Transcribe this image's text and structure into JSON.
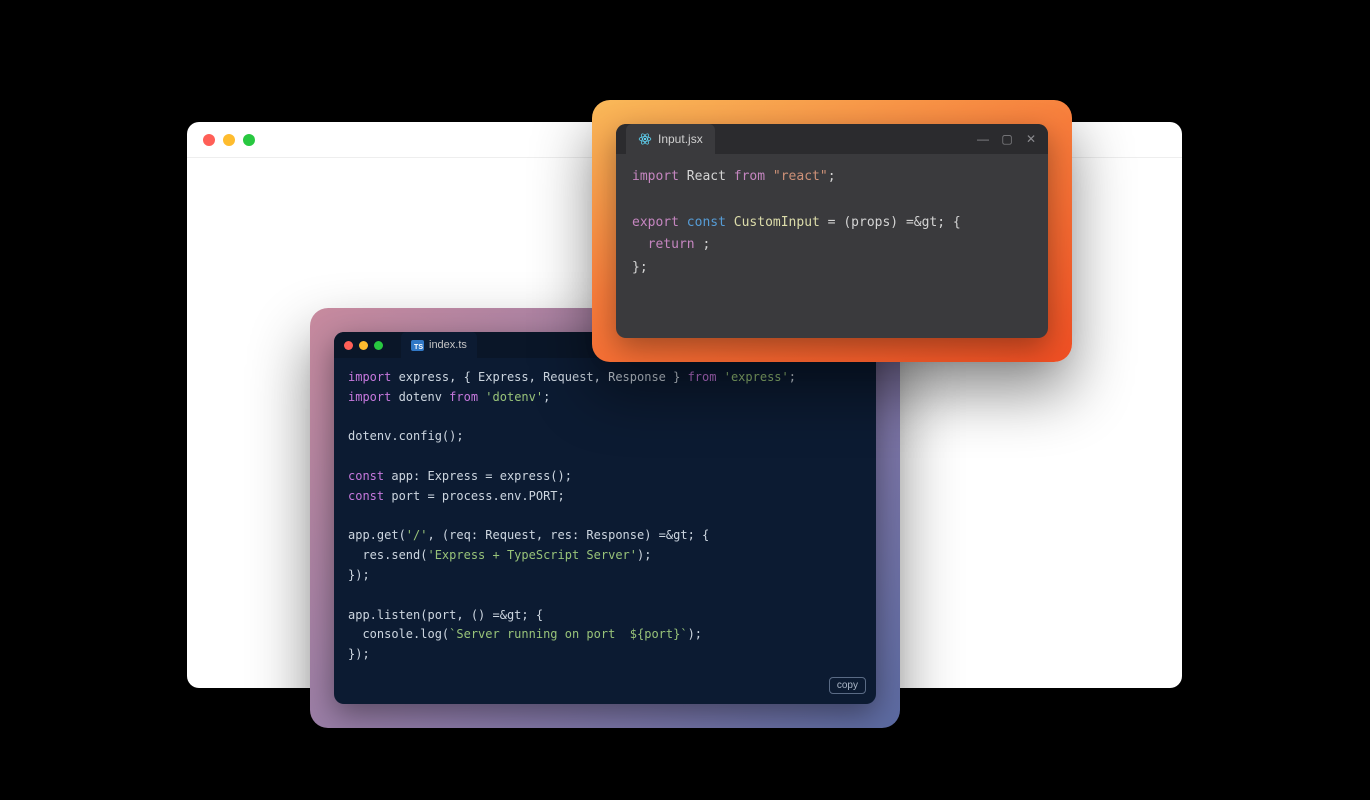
{
  "browser": {},
  "card1": {
    "tab": {
      "filename": "Input.jsx"
    },
    "code": {
      "l1": {
        "kw1": "import",
        "name": "React",
        "kw2": "from",
        "str": "\"react\"",
        "tail": ";"
      },
      "l3": {
        "kw1": "export",
        "kw2": "const",
        "fn": "CustomInput",
        "rest": " = (props) =&gt; {"
      },
      "l4": {
        "kw": "return",
        "rest": " ;"
      },
      "l5": "};"
    }
  },
  "card2": {
    "tab": {
      "filename": "index.ts",
      "badge": "TS"
    },
    "copy_label": "copy",
    "code": {
      "l1": {
        "kw1": "import",
        "mid": " express, { Express, Request, Response } ",
        "kw2": "from",
        "str": "'express'",
        "tail": ";"
      },
      "l2": {
        "kw1": "import",
        "mid": " dotenv ",
        "kw2": "from",
        "str": "'dotenv'",
        "tail": ";"
      },
      "l4": "dotenv.config();",
      "l6": {
        "kw": "const",
        "rest": " app: Express = express();"
      },
      "l7": {
        "kw": "const",
        "rest": " port = process.env.PORT;"
      },
      "l9": {
        "a": "app.get(",
        "str": "'/'",
        "b": ", (req: Request, res: Response) =&gt; {"
      },
      "l10": {
        "a": "  res.send(",
        "str": "'Express + TypeScript Server'",
        "b": ");"
      },
      "l11": "});",
      "l13": "app.listen(port, () =&gt; {",
      "l14": {
        "a": "  console.log(",
        "tmpl": "`Server running on port  ${port}`",
        "b": ");"
      },
      "l15": "});"
    }
  }
}
